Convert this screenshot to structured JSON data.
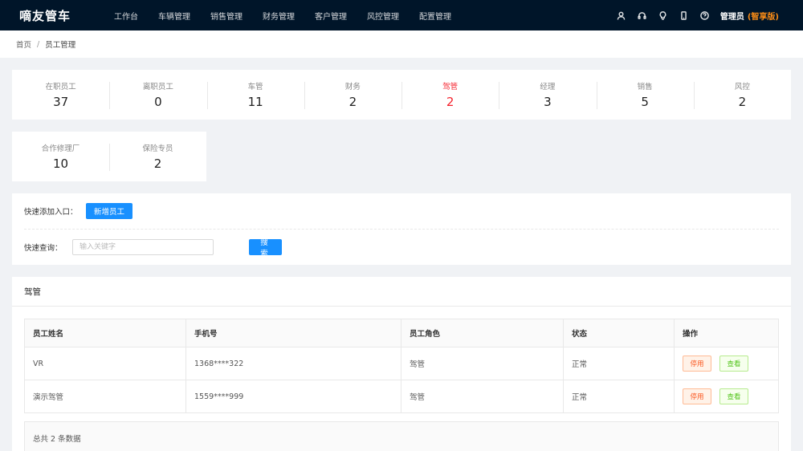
{
  "app": {
    "brand": "嘀友管车"
  },
  "nav": {
    "menu": [
      "工作台",
      "车辆管理",
      "销售管理",
      "财务管理",
      "客户管理",
      "风控管理",
      "配置管理"
    ],
    "icons": [
      "user-icon",
      "headset-icon",
      "bulb-icon",
      "mobile-icon",
      "help-icon"
    ],
    "user": "管理员",
    "edition": "(智享版)"
  },
  "breadcrumb": {
    "home": "首页",
    "sep": "/",
    "current": "员工管理"
  },
  "stats": {
    "row1": [
      {
        "label": "在职员工",
        "value": "37"
      },
      {
        "label": "离职员工",
        "value": "0"
      },
      {
        "label": "车管",
        "value": "11"
      },
      {
        "label": "财务",
        "value": "2"
      },
      {
        "label": "驾管",
        "value": "2"
      },
      {
        "label": "经理",
        "value": "3"
      },
      {
        "label": "销售",
        "value": "5"
      },
      {
        "label": "风控",
        "value": "2"
      }
    ],
    "row2": [
      {
        "label": "合作修理厂",
        "value": "10"
      },
      {
        "label": "保险专员",
        "value": "2"
      }
    ],
    "active_color": "#f5222d"
  },
  "quick": {
    "add_label": "快速添加入口：",
    "add_button": "新增员工",
    "search_label": "快速查询：",
    "search_placeholder": "输入关键字",
    "search_button": "搜 索"
  },
  "table": {
    "title": "驾管",
    "columns": [
      "员工姓名",
      "手机号",
      "员工角色",
      "状态",
      "操作"
    ],
    "rows": [
      {
        "name": "VR",
        "phone": "1368****322",
        "role": "驾管",
        "status": "正常",
        "disable": "停用",
        "view": "查看"
      },
      {
        "name": "演示驾管",
        "phone": "1559****999",
        "role": "驾管",
        "status": "正常",
        "disable": "停用",
        "view": "查看"
      }
    ],
    "total": "总共 2 条数据"
  },
  "colors": {
    "nav_bg": "#001529",
    "primary": "#1890ff",
    "edition": "#fa8c16"
  }
}
